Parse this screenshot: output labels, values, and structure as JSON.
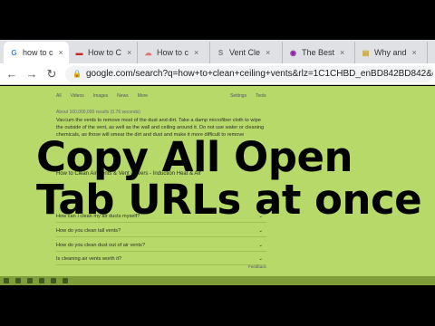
{
  "browser": {
    "tabs": [
      {
        "title": "how to c",
        "icon": "google-icon",
        "icon_char": "G",
        "icon_color": "#4285f4",
        "active": true
      },
      {
        "title": "How to C",
        "icon": "flag-icon",
        "icon_char": "▬",
        "icon_color": "#c62828",
        "active": false
      },
      {
        "title": "How to c",
        "icon": "cloud-icon",
        "icon_char": "☁",
        "icon_color": "#e57373",
        "active": false
      },
      {
        "title": "Vent Cle",
        "icon": "letter-s-icon",
        "icon_char": "S",
        "icon_color": "#777777",
        "active": false
      },
      {
        "title": "The Best",
        "icon": "globe-icon",
        "icon_char": "◉",
        "icon_color": "#8e24aa",
        "active": false
      },
      {
        "title": "Why and",
        "icon": "document-icon",
        "icon_char": "▤",
        "icon_color": "#c9a227",
        "active": false
      }
    ],
    "back_icon": "←",
    "forward_icon": "→",
    "reload_icon": "↻",
    "lock_icon": "🔒",
    "url": "google.com/search?q=how+to+clean+ceiling+vents&rlz=1C1CHBD_enBD842BD842&ei="
  },
  "results": {
    "search_tabs": [
      "All",
      "Videos",
      "Images",
      "News",
      "More"
    ],
    "settings": "Settings",
    "tools": "Tools",
    "stats": "About 160,000,000 results (0.76 seconds)",
    "snippet": "Vaccum the vents to remove most of the dust and dirt. Take a damp microfiber cloth to wipe the outside of the vent, as well as the wall and ceiling around it. Do not use water or cleaning chemicals, as those will smear the dirt and dust and make it more difficult to remove",
    "faq": [
      "How can I clean my air ducts myself?",
      "How do you clean tall vents?",
      "How do you clean dust out of air vents?",
      "Is cleaning air vents worth it?"
    ],
    "feedback": "Feedback",
    "partial_heading": "How to Clean Air Vents & Vent Covers - Induction Heat & Air"
  },
  "overlay": {
    "line1": "Copy All Open",
    "line2": "Tab URLs at once"
  },
  "colors": {
    "page_tint": "#b6d96a",
    "tabbar": "#dfe1e5"
  }
}
